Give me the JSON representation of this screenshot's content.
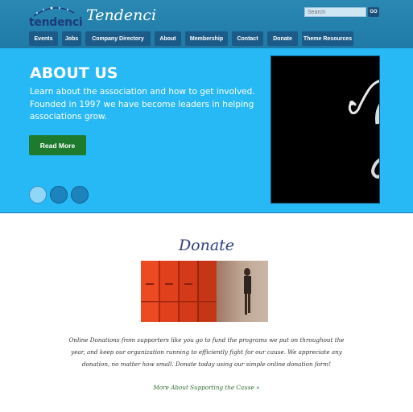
{
  "header": {
    "logo_text": "tendenci",
    "site_name": "Tendenci",
    "search": {
      "placeholder": "Search",
      "button_label": "GO"
    }
  },
  "nav": {
    "items": [
      {
        "label": "Events"
      },
      {
        "label": "Jobs"
      },
      {
        "label": "Company Directory"
      },
      {
        "label": "About"
      },
      {
        "label": "Membership"
      },
      {
        "label": "Contact"
      },
      {
        "label": "Donate"
      },
      {
        "label": "Theme Resources"
      }
    ]
  },
  "hero": {
    "title": "ABOUT US",
    "text": "Learn about the association and how to get involved. Founded in 1997 we have become leaders in helping associations grow.",
    "button_label": "Read More",
    "slides": {
      "count": 3,
      "active": 0
    }
  },
  "donate": {
    "title": "Donate",
    "text": "Online Donations from supporters like you go to fund the programs we put on throughout the year, and keep our organization running to efficiently fight for our cause. We appreciate any donation, no matter how small. Donate today using our simple online donation form!",
    "link_label": "More About Supporting the Cause »"
  },
  "colors": {
    "header_bg": "#2384b0",
    "hero_bg": "#27b9f6",
    "nav_bg": "#1c5a88",
    "button_green": "#1e7a2c",
    "donate_title": "#2f3f7e"
  }
}
